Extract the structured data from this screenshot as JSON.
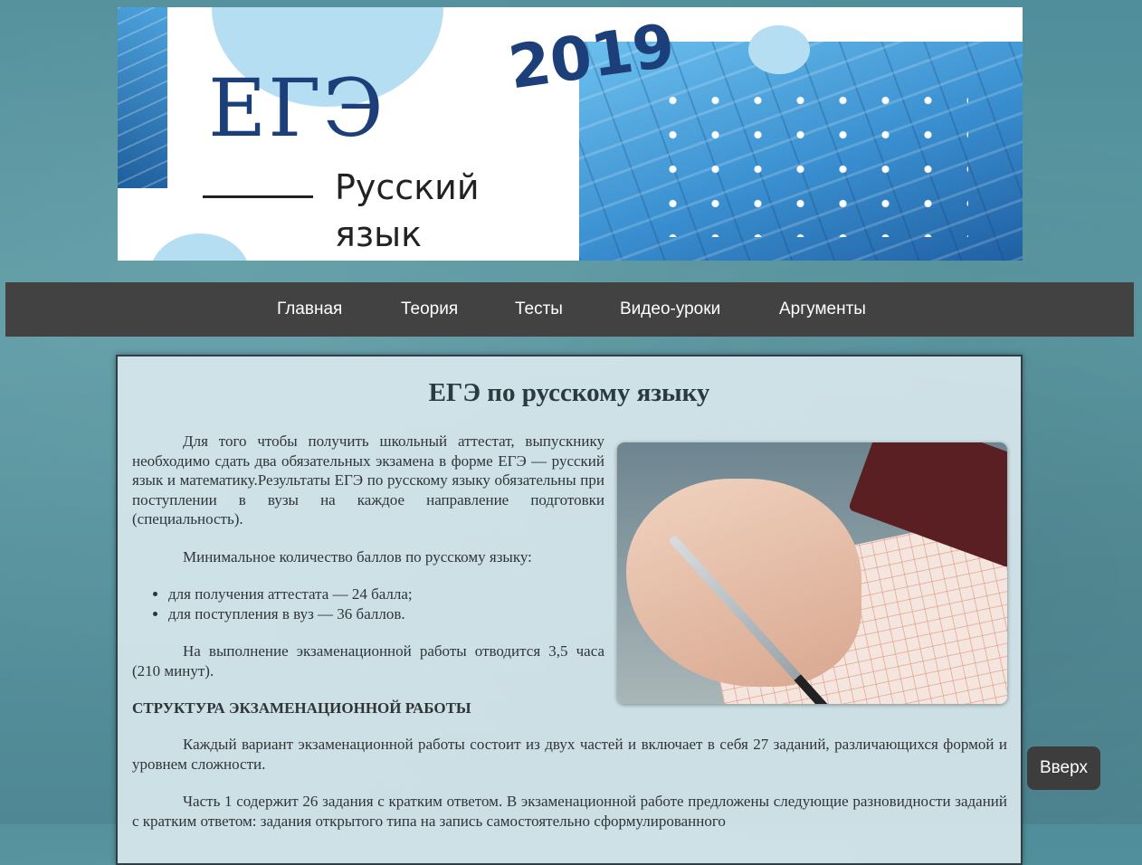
{
  "banner": {
    "title": "ЕГЭ",
    "year": "2019",
    "subject_line1": "Русский",
    "subject_line2": "язык"
  },
  "nav": {
    "items": [
      "Главная",
      "Теория",
      "Тесты",
      "Видео-уроки",
      "Аргументы"
    ]
  },
  "article": {
    "heading": "ЕГЭ по русскому языку",
    "intro": "Для того чтобы получить школьный аттестат, выпускнику необходимо сдать два обязательных экзамена в форме ЕГЭ — русский язык и математику.Результаты ЕГЭ по русскому языку обязательны при поступлении в вузы на каждое направление подготовки (специальность).",
    "min_scores": "Минимальное количество баллов по русскому языку:",
    "list": [
      "для получения аттестата — 24 балла;",
      "для поступления в вуз — 36 баллов."
    ],
    "duration": "На выполнение экзаменационной работы отводится 3,5 часа (210 минут).",
    "structure_heading": "СТРУКТУРА ЭКЗАМЕНАЦИОННОЙ РАБОТЫ",
    "structure_text": "Каждый вариант экзаменационной работы состоит из двух частей и включает в себя 27 заданий, различающихся формой и уровнем сложности.",
    "part1_text": "Часть 1 содержит 26 задания с кратким ответом. В экзаменационной работе предложены следующие разновидности заданий с кратким ответом: задания открытого типа на запись самостоятельно сформулированного"
  },
  "back_to_top": {
    "label": "Вверх"
  },
  "colors": {
    "nav_bg": "#424242",
    "heading": "#1c3f7a",
    "button_bg": "#3d3d3d"
  }
}
